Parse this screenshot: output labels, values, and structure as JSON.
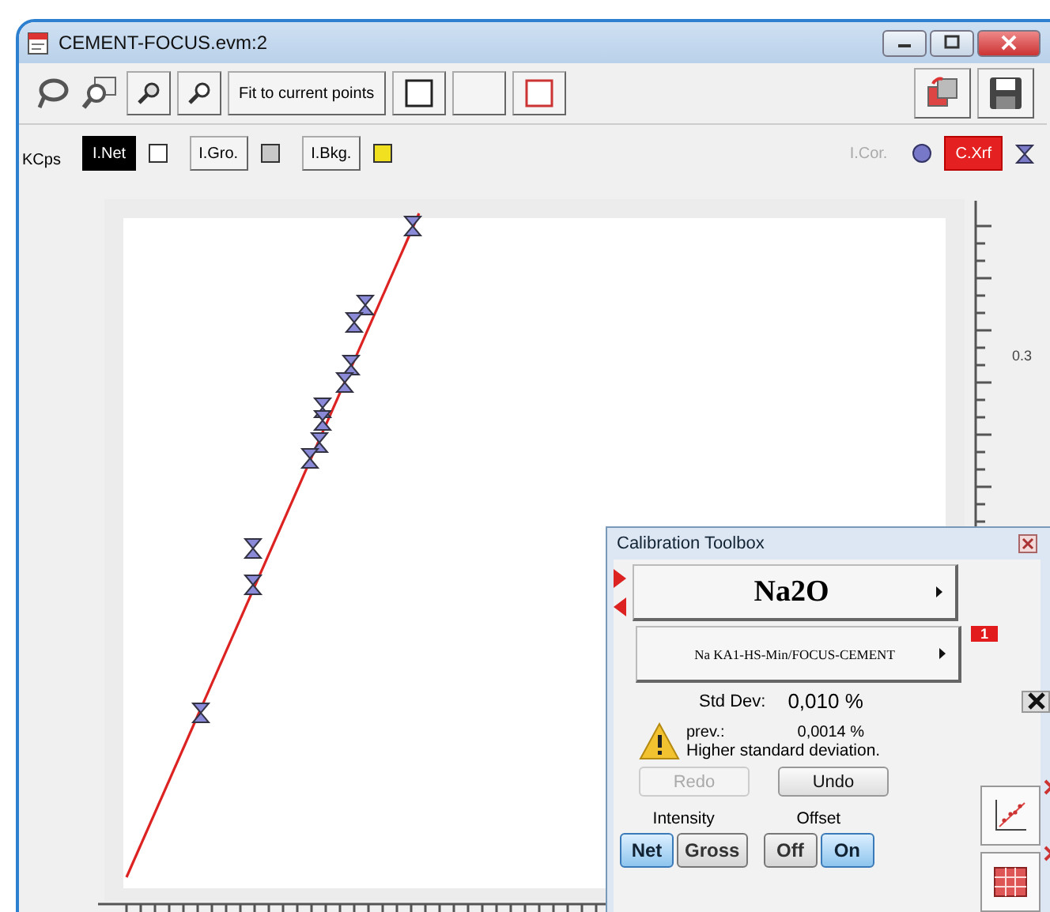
{
  "window": {
    "title": "CEMENT-FOCUS.evm:2"
  },
  "toolbar": {
    "fit_button": "Fit to current points"
  },
  "legend": {
    "unit": "KCps",
    "items": [
      {
        "label": "I.Net",
        "selected": true,
        "color": "#ffffff"
      },
      {
        "label": "I.Gro.",
        "selected": false,
        "color": "#c8c8c8"
      },
      {
        "label": "I.Bkg.",
        "selected": false,
        "color": "#f0e020"
      }
    ],
    "correction": {
      "label": "I.Cor.",
      "disabled": true,
      "color": "#7878c8"
    },
    "xrf": {
      "label": "C.Xrf",
      "selected": true
    }
  },
  "plot": {
    "axis_label": "0.3"
  },
  "toolbox": {
    "title": "Calibration Toolbox",
    "element": "Na2O",
    "line": "Na KA1-HS-Min/FOCUS-CEMENT",
    "badge": "1",
    "std_dev_label": "Std Dev:",
    "std_dev": "0,010 %",
    "prev_label": "prev.:",
    "prev": "0,0014 %",
    "warning": "Higher standard deviation.",
    "redo": {
      "label": "Redo",
      "disabled": true
    },
    "undo": {
      "label": "Undo",
      "disabled": false
    },
    "intensity": {
      "label": "Intensity",
      "options": [
        {
          "label": "Net",
          "selected": true
        },
        {
          "label": "Gross",
          "selected": false
        }
      ]
    },
    "offset": {
      "label": "Offset",
      "options": [
        {
          "label": "Off",
          "selected": false
        },
        {
          "label": "On",
          "selected": true
        }
      ]
    }
  }
}
